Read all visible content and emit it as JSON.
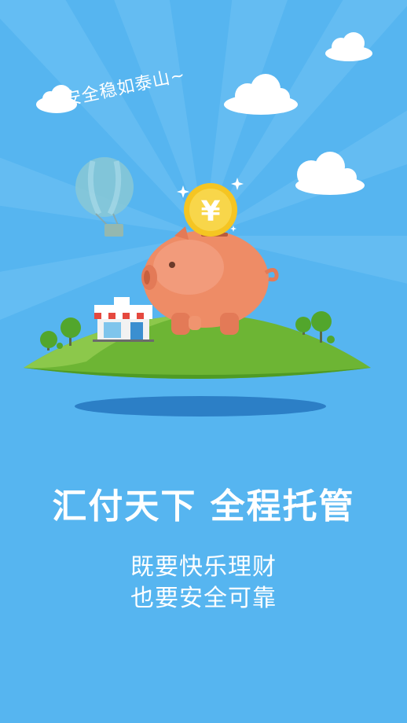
{
  "illustration": {
    "tagline": "安全稳如泰山~",
    "coin_symbol": "¥"
  },
  "headline": "汇付天下 全程托管",
  "subtitle_lines": [
    "既要快乐理财",
    "也要安全可靠"
  ],
  "colors": {
    "background": "#56b5f0",
    "ray": "#6cc1f4",
    "island": "#6db534",
    "pig": "#ee8c66",
    "coin": "#f5c522",
    "text": "#ffffff"
  }
}
